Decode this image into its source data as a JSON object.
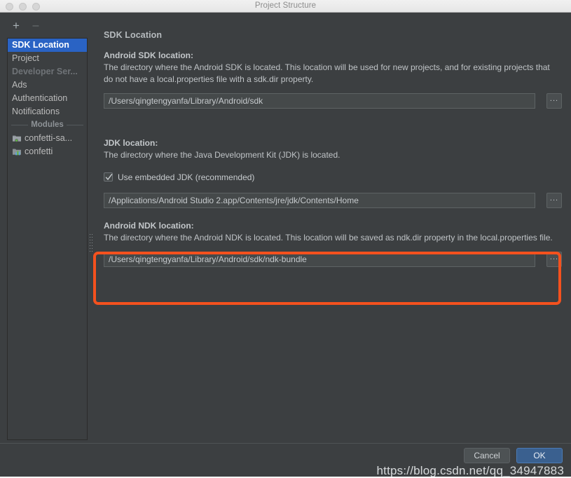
{
  "window": {
    "title": "Project Structure",
    "traffic_lights": [
      "close",
      "minimize",
      "zoom"
    ]
  },
  "toolbar": {
    "add_label": "+",
    "remove_label": "–"
  },
  "sidebar": {
    "items": [
      {
        "label": "SDK Location",
        "state": "selected"
      },
      {
        "label": "Project",
        "state": "normal"
      },
      {
        "label": "Developer Ser...",
        "state": "disabled"
      },
      {
        "label": "Ads",
        "state": "normal"
      },
      {
        "label": "Authentication",
        "state": "normal"
      },
      {
        "label": "Notifications",
        "state": "normal"
      }
    ],
    "group_label": "Modules",
    "modules": [
      {
        "label": "confetti-sa...",
        "icon": "android-module-icon"
      },
      {
        "label": "confetti",
        "icon": "library-module-icon"
      }
    ]
  },
  "main": {
    "panel_title": "SDK Location",
    "sections": [
      {
        "heading": "Android SDK location:",
        "description": "The directory where the Android SDK is located. This location will be used for new projects, and for existing projects that do not have a local.properties file with a sdk.dir property.",
        "value": "/Users/qingtengyanfa/Library/Android/sdk",
        "browse_label": "..."
      },
      {
        "heading": "JDK location:",
        "description": "The directory where the Java Development Kit (JDK) is located.",
        "checkbox_label": "Use embedded JDK (recommended)",
        "checkbox_checked": true,
        "value": "/Applications/Android Studio 2.app/Contents/jre/jdk/Contents/Home",
        "browse_label": "..."
      },
      {
        "heading": "Android NDK location:",
        "description": "The directory where the Android NDK is located. This location will be saved as ndk.dir property in the local.properties file.",
        "value": "/Users/qingtengyanfa/Library/Android/sdk/ndk-bundle",
        "browse_label": "..."
      }
    ]
  },
  "footer": {
    "cancel_label": "Cancel",
    "ok_label": "OK"
  },
  "overlay": {
    "watermark": "https://blog.csdn.net/qq_34947883",
    "highlight_color": "#f4511e"
  },
  "colors": {
    "window_bg": "#3c3f41",
    "selection_blue": "#2a63c4",
    "default_button_blue": "#3a608f",
    "highlight_orange": "#f4511e"
  }
}
